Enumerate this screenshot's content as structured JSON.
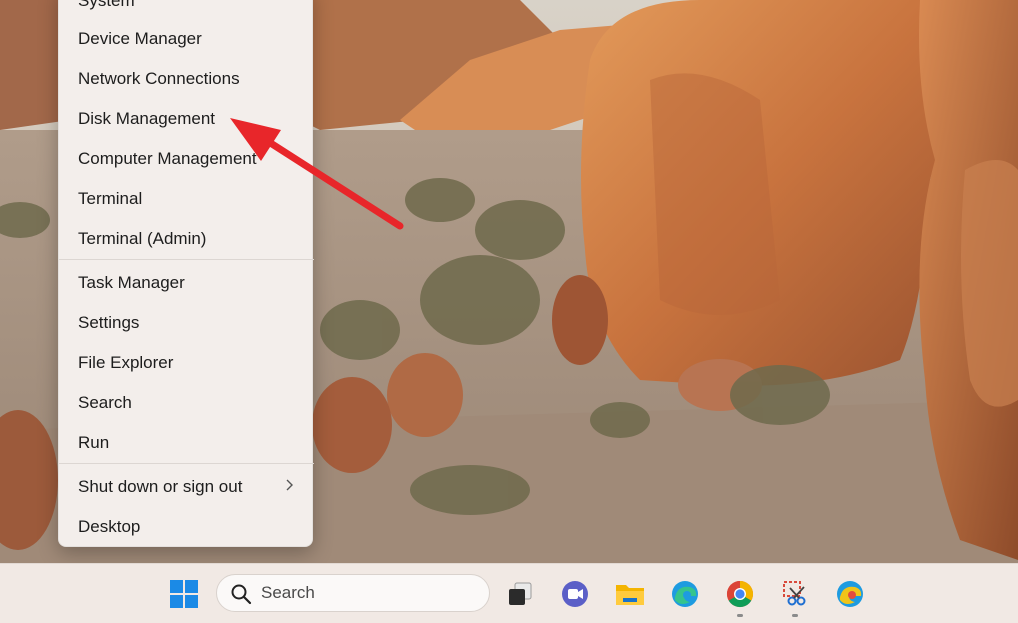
{
  "context_menu": {
    "items": [
      {
        "label": "System"
      },
      {
        "label": "Device Manager"
      },
      {
        "label": "Network Connections"
      },
      {
        "label": "Disk Management"
      },
      {
        "label": "Computer Management"
      },
      {
        "label": "Terminal"
      },
      {
        "label": "Terminal (Admin)"
      },
      {
        "label": "Task Manager"
      },
      {
        "label": "Settings"
      },
      {
        "label": "File Explorer"
      },
      {
        "label": "Search"
      },
      {
        "label": "Run"
      },
      {
        "label": "Shut down or sign out",
        "submenu_icon": "chevron-right-icon"
      },
      {
        "label": "Desktop"
      }
    ]
  },
  "annotation": {
    "type": "arrow",
    "color": "#e8262a",
    "points_to": "Disk Management"
  },
  "taskbar": {
    "search": {
      "placeholder": "Search",
      "icon": "search-icon"
    },
    "icons": [
      {
        "name": "windows-start-icon"
      },
      {
        "name": "task-view-icon"
      },
      {
        "name": "teams-meet-icon"
      },
      {
        "name": "file-explorer-icon"
      },
      {
        "name": "edge-browser-icon"
      },
      {
        "name": "chrome-browser-icon"
      },
      {
        "name": "snipping-tool-icon"
      },
      {
        "name": "edge-canary-browser-icon"
      }
    ]
  },
  "colors": {
    "menu_bg": "#f3eeeb",
    "taskbar_bg": "#f1e9e4",
    "arrow": "#e8262a"
  }
}
